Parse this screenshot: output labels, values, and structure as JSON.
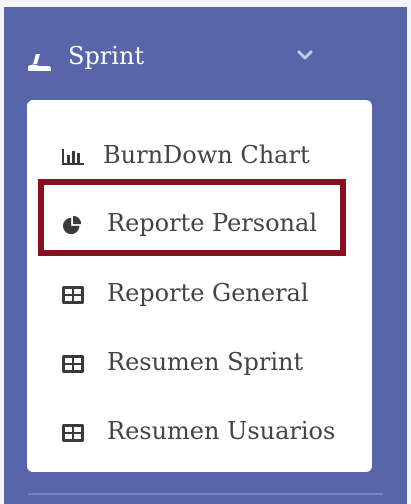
{
  "menu": {
    "label": "Sprint",
    "icon": "sprint-icon",
    "chevron_icon": "chevron-down-icon"
  },
  "submenu": {
    "items": [
      {
        "label": "BurnDown Chart",
        "icon": "bar-chart-icon"
      },
      {
        "label": "Reporte Personal",
        "icon": "pie-chart-icon",
        "highlighted": true
      },
      {
        "label": "Reporte General",
        "icon": "table-icon"
      },
      {
        "label": "Resumen Sprint",
        "icon": "table-icon"
      },
      {
        "label": "Resumen Usuarios",
        "icon": "table-icon"
      }
    ]
  },
  "colors": {
    "sidebar_bg": "#5865a9",
    "submenu_bg": "#ffffff",
    "highlight": "#8b0f20",
    "text": "#444444",
    "header_text": "#ffffff"
  }
}
